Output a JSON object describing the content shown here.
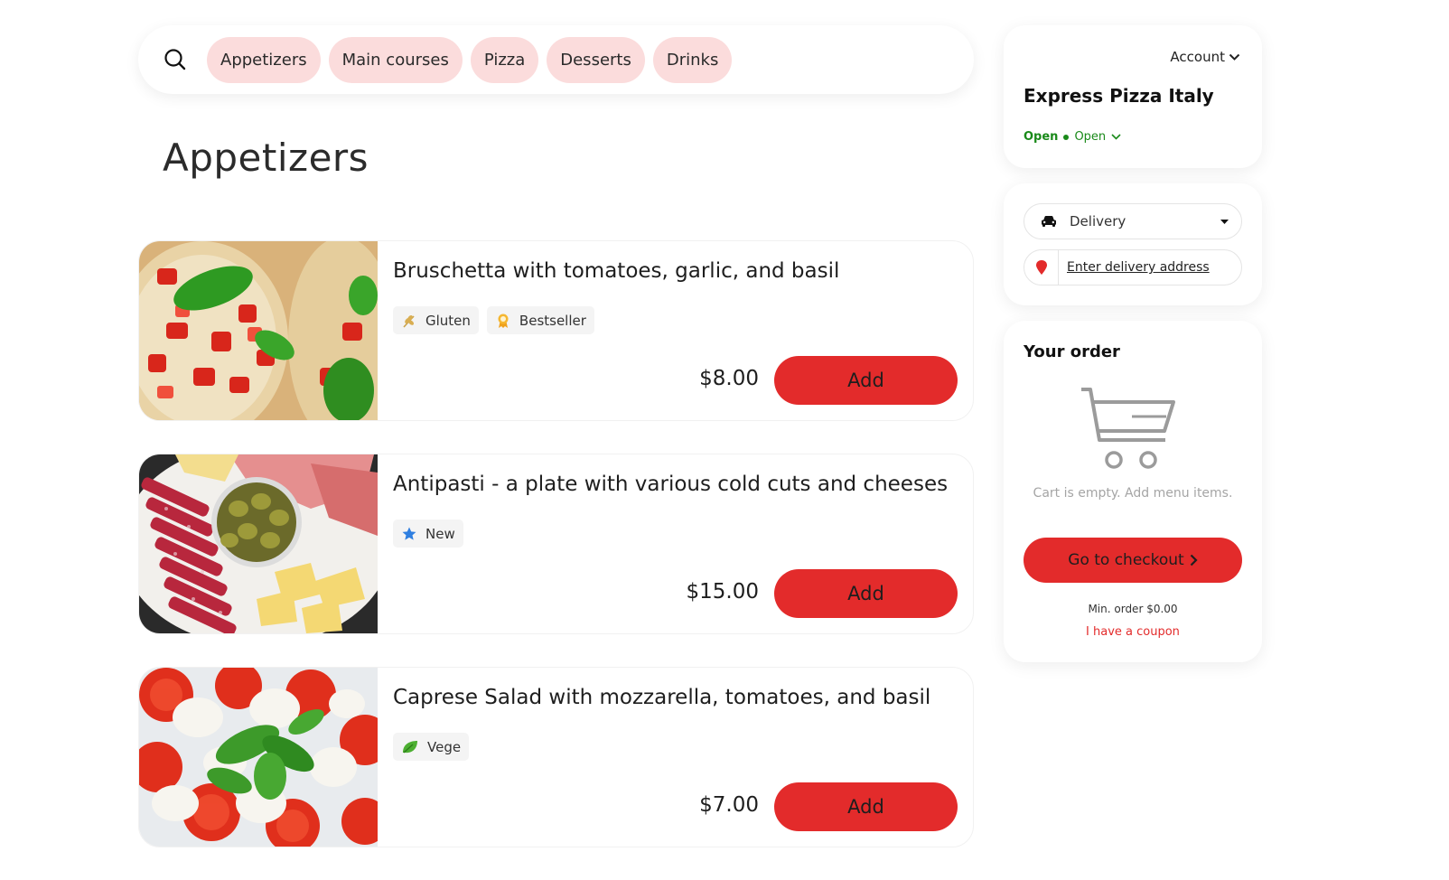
{
  "categories": [
    {
      "label": "Appetizers"
    },
    {
      "label": "Main courses"
    },
    {
      "label": "Pizza"
    },
    {
      "label": "Desserts"
    },
    {
      "label": "Drinks"
    }
  ],
  "section": {
    "title": "Appetizers"
  },
  "items": [
    {
      "name": "Bruschetta with tomatoes, garlic, and basil",
      "badges": [
        {
          "label": "Gluten",
          "icon": "wheat-icon"
        },
        {
          "label": "Bestseller",
          "icon": "award-icon"
        }
      ],
      "price": "$8.00",
      "button": "Add"
    },
    {
      "name": "Antipasti - a plate with various cold cuts and cheeses",
      "badges": [
        {
          "label": "New",
          "icon": "star-icon"
        }
      ],
      "price": "$15.00",
      "button": "Add"
    },
    {
      "name": "Caprese Salad with mozzarella, tomatoes, and basil",
      "badges": [
        {
          "label": "Vege",
          "icon": "leaf-icon"
        }
      ],
      "price": "$7.00",
      "button": "Add"
    }
  ],
  "restaurant": {
    "account_label": "Account",
    "name": "Express Pizza Italy",
    "status_label": "Open",
    "status_selected": "Open"
  },
  "delivery": {
    "mode": "Delivery",
    "address_placeholder": "Enter delivery address"
  },
  "order": {
    "title": "Your order",
    "empty_text": "Cart is empty. Add menu items.",
    "checkout_label": "Go to checkout",
    "min_order": "Min. order $0.00",
    "coupon_label": "I have a coupon"
  },
  "colors": {
    "accent": "#e32b2b",
    "category_bg": "#fbdcdc",
    "open_green": "#1a8a1a"
  }
}
